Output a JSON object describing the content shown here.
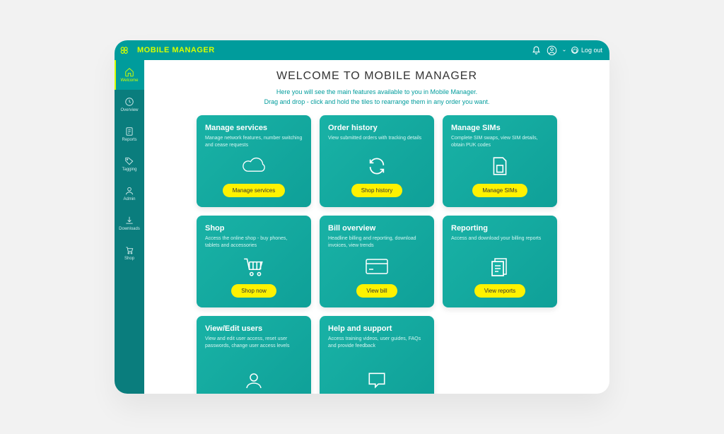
{
  "header": {
    "app_title": "MOBILE MANAGER",
    "logout_label": "Log out"
  },
  "sidebar": {
    "items": [
      {
        "label": "Welcome",
        "icon": "home-icon",
        "active": true
      },
      {
        "label": "Overview",
        "icon": "clock-icon",
        "active": false
      },
      {
        "label": "Reports",
        "icon": "report-icon",
        "active": false
      },
      {
        "label": "Tagging",
        "icon": "tag-icon",
        "active": false
      },
      {
        "label": "Admin",
        "icon": "user-icon",
        "active": false
      },
      {
        "label": "Downloads",
        "icon": "download-icon",
        "active": false
      },
      {
        "label": "Shop",
        "icon": "cart-icon",
        "active": false
      }
    ]
  },
  "welcome": {
    "title": "WELCOME TO MOBILE MANAGER",
    "sub1": "Here you will see the main features available to you in Mobile Manager.",
    "sub2": "Drag and drop - click and hold the tiles to rearrange them in any order you want."
  },
  "tiles": [
    {
      "title": "Manage services",
      "desc": "Manage network features, number switching and cease requests",
      "button": "Manage services",
      "icon": "cloud-icon"
    },
    {
      "title": "Order history",
      "desc": "View submitted orders with tracking details",
      "button": "Shop history",
      "icon": "refresh-icon"
    },
    {
      "title": "Manage SIMs",
      "desc": "Complete SIM swaps, view SIM details, obtain PUK codes",
      "button": "Manage SIMs",
      "icon": "sim-icon"
    },
    {
      "title": "Shop",
      "desc": "Access the online shop - buy phones, tablets and accessories",
      "button": "Shop now",
      "icon": "cart-large-icon"
    },
    {
      "title": "Bill overview",
      "desc": "Headline billing and reporting, download invoices, view trends",
      "button": "View bill",
      "icon": "card-icon"
    },
    {
      "title": "Reporting",
      "desc": "Access and download your billing reports",
      "button": "View reports",
      "icon": "reports-icon"
    },
    {
      "title": "View/Edit users",
      "desc": "View and edit user access, reset user passwords, change user access levels",
      "button": "",
      "icon": "users-icon"
    },
    {
      "title": "Help and support",
      "desc": "Access training videos, user guides, FAQs and provide feedback",
      "button": "",
      "icon": "help-icon"
    }
  ]
}
